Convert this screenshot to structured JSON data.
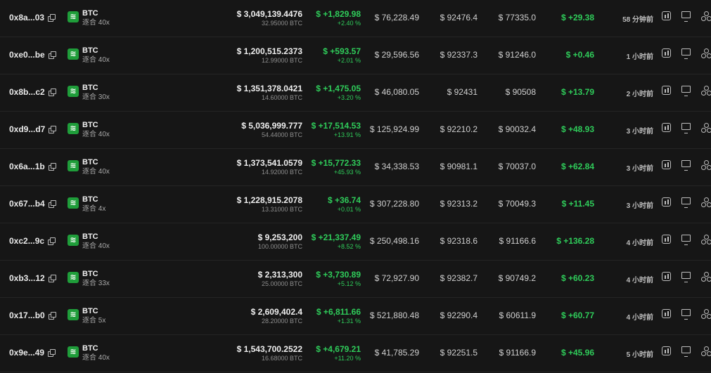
{
  "columns": [
    "address",
    "asset",
    "size",
    "pnl",
    "entry_price",
    "mark_price",
    "liq_price",
    "funding",
    "time",
    "actions"
  ],
  "colors": {
    "positive": "#2fcc5a",
    "asset_icon_bg": "#1f9d3a"
  },
  "icons": {
    "asset": "btc-icon",
    "copy": "copy-icon",
    "chart": "chart-icon",
    "monitor": "monitor-icon",
    "share": "share-icon"
  },
  "rows": [
    {
      "address": "0x8a...03",
      "asset": "BTC",
      "leverage": "逐合 40x",
      "size_usd": "$ 3,049,139.4476",
      "size_btc": "32.95000 BTC",
      "pnl": "$ +1,829.98",
      "pnl_pct": "+2.40 %",
      "entry": "$ 76,228.49",
      "mark": "$ 92476.4",
      "liq": "$ 77335.0",
      "funding": "$ +29.38",
      "time": "58 分钟前"
    },
    {
      "address": "0xe0...be",
      "asset": "BTC",
      "leverage": "逐合 40x",
      "size_usd": "$ 1,200,515.2373",
      "size_btc": "12.99000 BTC",
      "pnl": "$ +593.57",
      "pnl_pct": "+2.01 %",
      "entry": "$ 29,596.56",
      "mark": "$ 92337.3",
      "liq": "$ 91246.0",
      "funding": "$ +0.46",
      "time": "1 小时前"
    },
    {
      "address": "0x8b...c2",
      "asset": "BTC",
      "leverage": "逐合 30x",
      "size_usd": "$ 1,351,378.0421",
      "size_btc": "14.60000 BTC",
      "pnl": "$ +1,475.05",
      "pnl_pct": "+3.20 %",
      "entry": "$ 46,080.05",
      "mark": "$ 92431",
      "liq": "$ 90508",
      "funding": "$ +13.79",
      "time": "2 小时前"
    },
    {
      "address": "0xd9...d7",
      "asset": "BTC",
      "leverage": "逐合 40x",
      "size_usd": "$ 5,036,999.777",
      "size_btc": "54.44000 BTC",
      "pnl": "$ +17,514.53",
      "pnl_pct": "+13.91 %",
      "entry": "$ 125,924.99",
      "mark": "$ 92210.2",
      "liq": "$ 90032.4",
      "funding": "$ +48.93",
      "time": "3 小时前"
    },
    {
      "address": "0x6a...1b",
      "asset": "BTC",
      "leverage": "逐合 40x",
      "size_usd": "$ 1,373,541.0579",
      "size_btc": "14.92000 BTC",
      "pnl": "$ +15,772.33",
      "pnl_pct": "+45.93 %",
      "entry": "$ 34,338.53",
      "mark": "$ 90981.1",
      "liq": "$ 70037.0",
      "funding": "$ +62.84",
      "time": "3 小时前"
    },
    {
      "address": "0x67...b4",
      "asset": "BTC",
      "leverage": "逐合 4x",
      "size_usd": "$ 1,228,915.2078",
      "size_btc": "13.31000 BTC",
      "pnl": "$ +36.74",
      "pnl_pct": "+0.01 %",
      "entry": "$ 307,228.80",
      "mark": "$ 92313.2",
      "liq": "$ 70049.3",
      "funding": "$ +11.45",
      "time": "3 小时前"
    },
    {
      "address": "0xc2...9c",
      "asset": "BTC",
      "leverage": "逐合 40x",
      "size_usd": "$ 9,253,200",
      "size_btc": "100.00000 BTC",
      "pnl": "$ +21,337.49",
      "pnl_pct": "+8.52 %",
      "entry": "$ 250,498.16",
      "mark": "$ 92318.6",
      "liq": "$ 91166.6",
      "funding": "$ +136.28",
      "time": "4 小时前"
    },
    {
      "address": "0xb3...12",
      "asset": "BTC",
      "leverage": "逐合 33x",
      "size_usd": "$ 2,313,300",
      "size_btc": "25.00000 BTC",
      "pnl": "$ +3,730.89",
      "pnl_pct": "+5.12 %",
      "entry": "$ 72,927.90",
      "mark": "$ 92382.7",
      "liq": "$ 90749.2",
      "funding": "$ +60.23",
      "time": "4 小时前"
    },
    {
      "address": "0x17...b0",
      "asset": "BTC",
      "leverage": "逐合 5x",
      "size_usd": "$ 2,609,402.4",
      "size_btc": "28.20000 BTC",
      "pnl": "$ +6,811.66",
      "pnl_pct": "+1.31 %",
      "entry": "$ 521,880.48",
      "mark": "$ 92290.4",
      "liq": "$ 60611.9",
      "funding": "$ +60.77",
      "time": "4 小时前"
    },
    {
      "address": "0x9e...49",
      "asset": "BTC",
      "leverage": "逐合 40x",
      "size_usd": "$ 1,543,700.2522",
      "size_btc": "16.68000 BTC",
      "pnl": "$ +4,679.21",
      "pnl_pct": "+11.20 %",
      "entry": "$ 41,785.29",
      "mark": "$ 92251.5",
      "liq": "$ 91166.9",
      "funding": "$ +45.96",
      "time": "5 小时前"
    }
  ]
}
